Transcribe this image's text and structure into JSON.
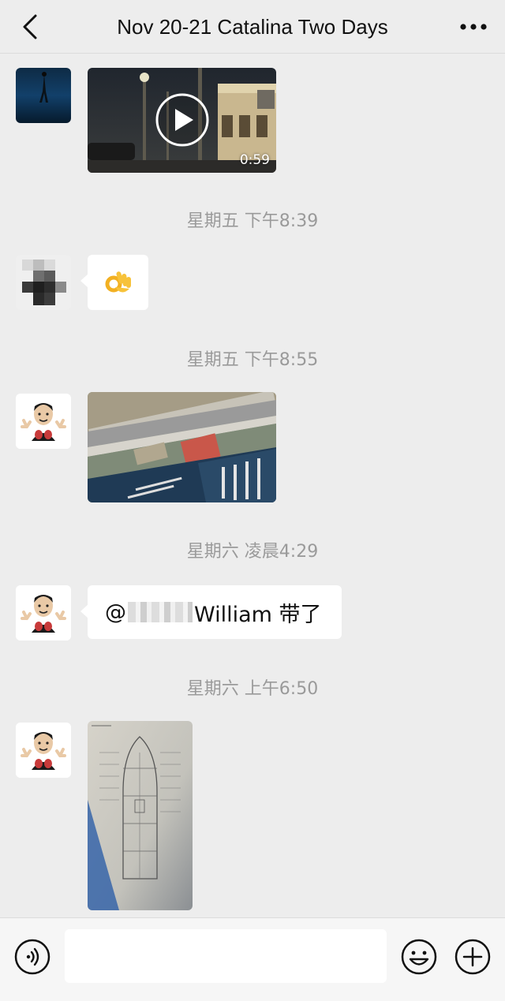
{
  "header": {
    "title": "Nov 20-21 Catalina Two Days",
    "back_icon": "chevron-left-icon",
    "more_icon": "more-dots-icon"
  },
  "messages": [
    {
      "type": "video",
      "duration": "0:59"
    },
    {
      "timestamp": "星期五 下午8:39",
      "type": "emoji",
      "emoji": "👌"
    },
    {
      "timestamp": "星期五 下午8:55",
      "type": "image",
      "description": "aerial-map-image"
    },
    {
      "timestamp": "星期六 凌晨4:29",
      "type": "text",
      "text_prefix": "@",
      "text_suffix": "William 带了"
    },
    {
      "timestamp": "星期六 上午6:50",
      "type": "image",
      "description": "boat-floor-plan-image"
    }
  ],
  "input_bar": {
    "voice_icon": "voice-icon",
    "emoji_icon": "emoji-icon",
    "plus_icon": "plus-icon",
    "placeholder": ""
  }
}
